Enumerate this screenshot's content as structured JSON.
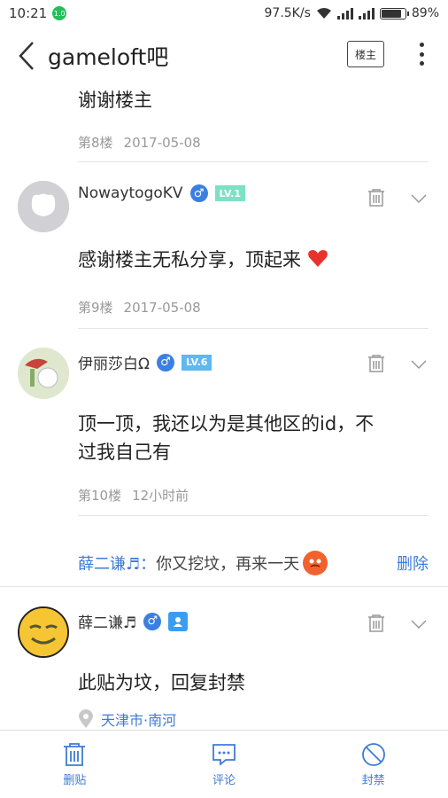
{
  "status": {
    "time": "10:21",
    "badge": "1.0",
    "speed": "97.5K/s",
    "battery": "89%",
    "battery_level": 0.89
  },
  "header": {
    "back_icon": "chevron-left-icon",
    "title": "gameloft吧",
    "floor_button": "楼主",
    "more_icon": "more-vertical-icon"
  },
  "posts": [
    {
      "text": "谢谢楼主",
      "floor": "第8楼",
      "time": "2017-05-08"
    },
    {
      "username": "NowaytogoKV",
      "level": "LV.1",
      "text": "感谢楼主无私分享，顶起来",
      "floor": "第9楼",
      "time": "2017-05-08"
    },
    {
      "username": "伊丽莎白Ω",
      "level": "LV.6",
      "text_line1": "顶一顶，我还以为是其他区的id，不",
      "text_line2": "过我自己有",
      "floor": "第10楼",
      "time": "12小时前"
    },
    {
      "username": "薛二谦♬",
      "text": "此贴为坟，回复封禁",
      "location": "天津市·南河"
    }
  ],
  "reply": {
    "who": "薛二谦♬：",
    "text": "你又挖坟，再来一天",
    "delete": "删除"
  },
  "bottom": {
    "tab1": "删贴",
    "tab2": "评论",
    "tab3": "封禁"
  },
  "colors": {
    "accent": "#3e7bd6",
    "lv1": "#7ee0c4",
    "lv6": "#5fb8f0"
  }
}
